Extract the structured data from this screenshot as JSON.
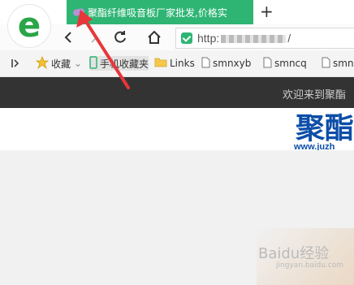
{
  "browser": {
    "active_tab_title": "聚酯纤维吸音板厂家批发,价格实",
    "new_tab_label": "+",
    "address": "http:",
    "address_suffix": "/",
    "icons": {
      "logo": "browser-e-logo-icon",
      "back": "back-arrow-icon",
      "forward": "forward-arrow-icon",
      "refresh": "refresh-icon",
      "home": "home-icon",
      "secure": "shield-check-icon"
    }
  },
  "bookmarks": {
    "toggle": "sidebar-toggle-icon",
    "items": [
      {
        "label": "收藏",
        "icon": "star-icon"
      },
      {
        "label": "手机收藏夹",
        "icon": "phone-icon"
      },
      {
        "label": "Links",
        "icon": "folder-icon"
      },
      {
        "label": "smnxyb",
        "icon": "page-icon"
      },
      {
        "label": "smncq",
        "icon": "page-icon"
      },
      {
        "label": "smn",
        "icon": "page-icon"
      }
    ]
  },
  "site": {
    "welcome": "欢迎来到聚酯",
    "brand": "聚酯",
    "brand_url": "www.juzh"
  },
  "watermark": {
    "text": "Baidu经验",
    "sub": "jingyan.baidu.com"
  },
  "colors": {
    "tab_active": "#2eb574",
    "logo_green": "#2aa547",
    "header_dark": "#333333",
    "brand_blue": "#0d4ea8",
    "annotation_red": "#e8363b"
  }
}
